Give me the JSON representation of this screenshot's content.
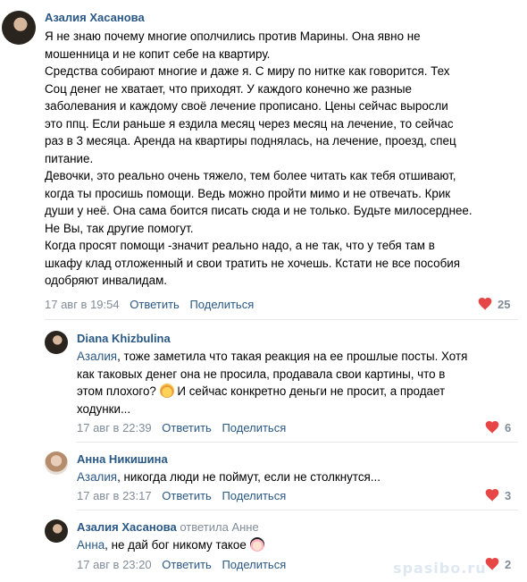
{
  "comments": [
    {
      "author": "Азалия Хасанова",
      "lines": [
        "Я не знаю почему многие ополчились против Марины. Она явно не",
        "мошенница и не копит себе на квартиру.",
        "Средства собирают многие и даже я. С миру по нитке как говорится. Тех",
        "Соц денег не хватает, что приходят. У каждого конечно же разные",
        "заболевания и каждому своё лечение прописано. Цены сейчас выросли",
        "это ппц. Если раньше я ездила месяц через месяц на лечение, то сейчас",
        "раз в 3 месяца. Аренда на квартиры поднялась, на лечение, проезд, спец",
        "питание.",
        "Девочки, это реально очень тяжело, тем более читать как тебя отшивают,",
        "когда ты просишь помощи. Ведь можно пройти мимо и не отвечать. Крик",
        "души у неё. Она сама боится писать сюда и не только. Будьте милосерднее.",
        "Не Вы, так другие помогут.",
        "Когда просят помощи -значит реально надо, а не так, что у тебя там в",
        "шкафу клад отложенный и свои тратить не хочешь. Кстати не все пособия",
        "одобряют инвалидам."
      ],
      "date": "17 авг в 19:54",
      "reply": "Ответить",
      "share": "Поделиться",
      "likes": "25"
    },
    {
      "author": "Diana Khizbulina",
      "mention": "Азалия",
      "lines": [
        ", тоже заметила что такая реакция на ее прошлые посты. Хотя",
        "как таковых денег она не просила, продавала свои картины, что в",
        "этом плохого?",
        " И сейчас конкретно деньги не просит, а продает",
        "ходунки..."
      ],
      "date": "17 авг в 22:39",
      "reply": "Ответить",
      "share": "Поделиться",
      "likes": "6"
    },
    {
      "author": "Анна Никишина",
      "mention": "Азалия",
      "lines": [
        ", никогда люди не поймут, если не столкнутся..."
      ],
      "date": "17 авг в 23:17",
      "reply": "Ответить",
      "share": "Поделиться",
      "likes": "3"
    },
    {
      "author": "Азалия Хасанова",
      "reply_note": "ответила Анне",
      "mention": "Анна",
      "lines": [
        ", не дай бог никому такое"
      ],
      "date": "17 авг в 23:20",
      "reply": "Ответить",
      "share": "Поделиться",
      "likes": "2"
    }
  ],
  "icons": {
    "like": "heart-icon",
    "emoji_1": "emoji-face-icon",
    "emoji_2": "emoji-face-mask-icon"
  },
  "colors": {
    "link": "#2a5885",
    "meta": "#818c99",
    "heart": "#e64646",
    "divider": "#e7e8ec"
  },
  "watermark": "spasibo.ru"
}
